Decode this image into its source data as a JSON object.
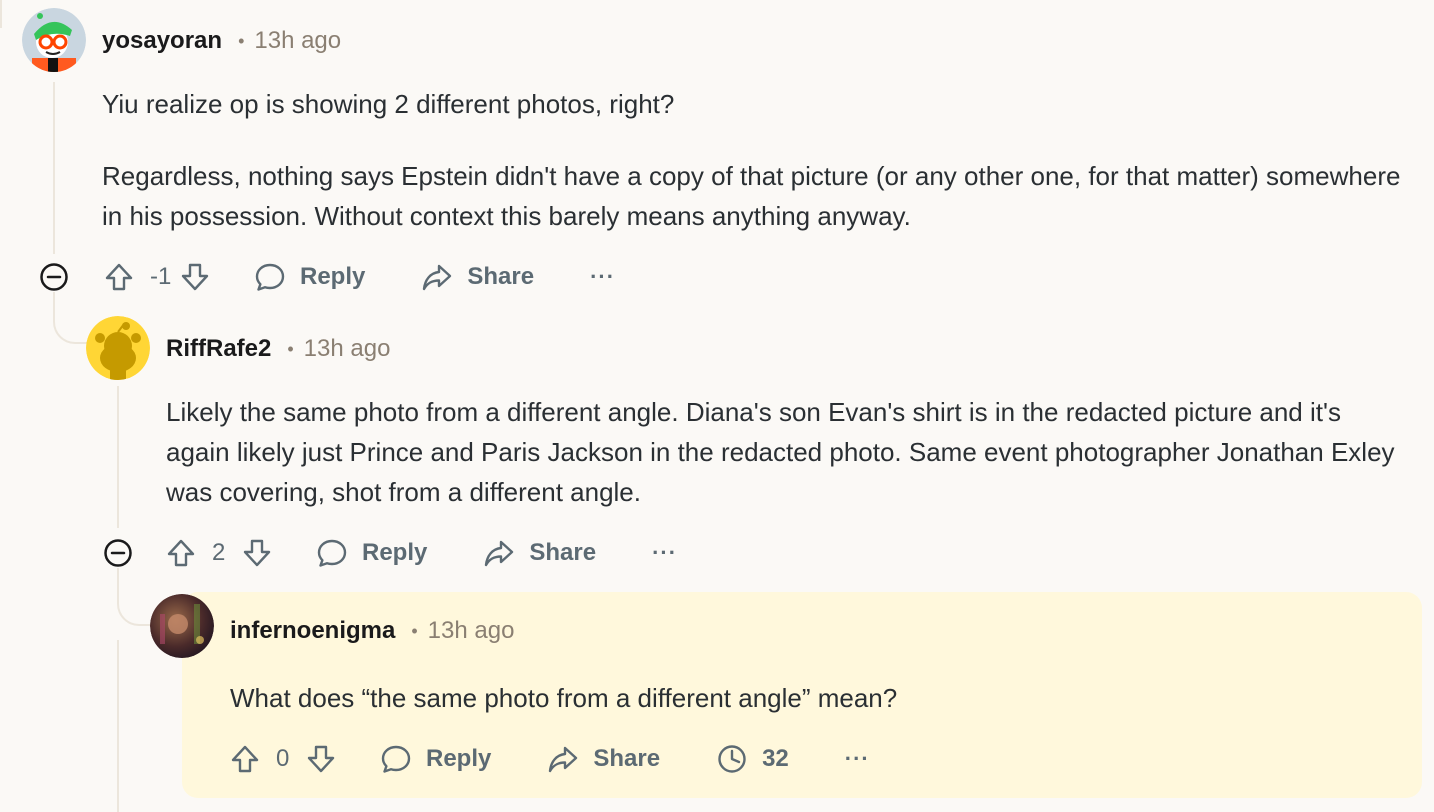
{
  "comments": [
    {
      "username": "yosayoran",
      "time": "13h ago",
      "paragraphs": [
        "Yiu realize op is showing 2 different photos, right?",
        "Regardless, nothing says Epstein didn't have a copy of that picture (or any other one, for that matter) somewhere in his possession. Without context this barely means anything anyway."
      ],
      "score": "-1",
      "reply_label": "Reply",
      "share_label": "Share",
      "more_label": "···"
    },
    {
      "username": "RiffRafe2",
      "time": "13h ago",
      "paragraphs": [
        "Likely the same photo from a different angle. Diana's son Evan's shirt is in the redacted picture and it's again likely just Prince and Paris Jackson in the redacted photo. Same event photographer Jonathan Exley was covering, shot from a different angle."
      ],
      "score": "2",
      "reply_label": "Reply",
      "share_label": "Share",
      "more_label": "···"
    },
    {
      "username": "infernoenigma",
      "time": "13h ago",
      "paragraphs": [
        "What does “the same photo from a different angle” mean?"
      ],
      "score": "0",
      "reply_label": "Reply",
      "share_label": "Share",
      "insights_count": "32",
      "more_label": "···"
    }
  ],
  "colors": {
    "background": "#fbf9f6",
    "highlight": "#fff8dc",
    "thread_line": "#ece6dc",
    "action_text": "#5c6a73",
    "meta_text": "#8a7f72"
  },
  "icons": [
    "upvote-icon",
    "downvote-icon",
    "reply-icon",
    "share-icon",
    "insights-icon",
    "collapse-icon",
    "more-icon"
  ]
}
